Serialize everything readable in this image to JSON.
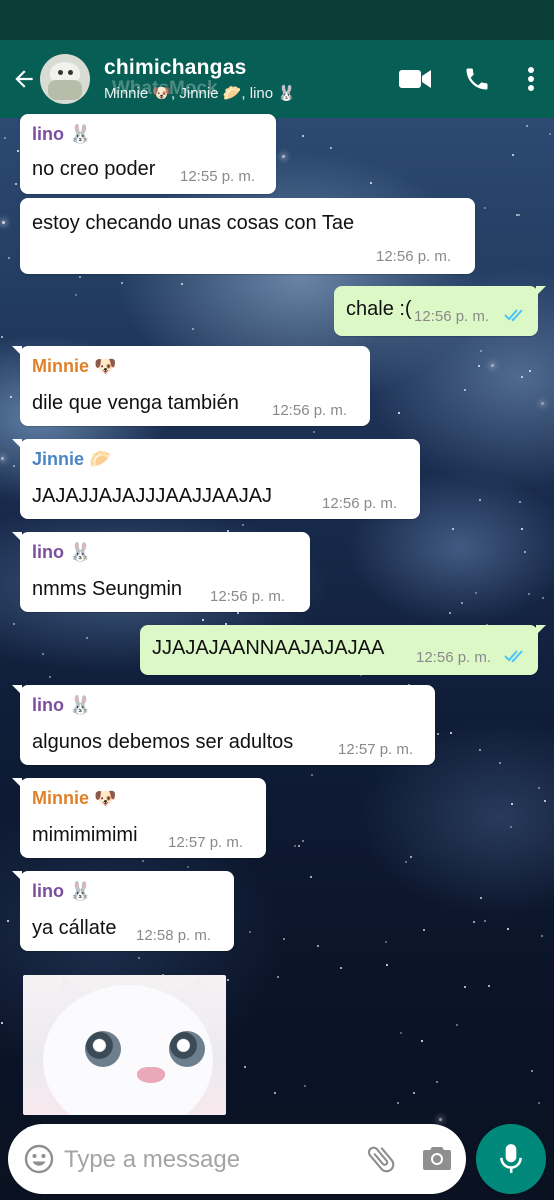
{
  "header": {
    "chat_name": "chimichangas",
    "members": "Minnie 🐶, Jinnie 🥟, lino 🐰",
    "watermark": "WhatsMock"
  },
  "colors": {
    "header": "#075e54",
    "status_bar": "#0a3d35",
    "outgoing_bubble": "#dcf8c6",
    "incoming_bubble": "#ffffff",
    "read_ticks": "#4fc3f7",
    "mic_button": "#00897b",
    "sender_lino": "#7b4f9e",
    "sender_minnie": "#e0812a",
    "sender_jinnie": "#4a86c5"
  },
  "messages": [
    {
      "dir": "in",
      "sender": "lino 🐰",
      "text": "no creo poder",
      "time": "12:55 p. m."
    },
    {
      "dir": "in",
      "sender": "",
      "text": "estoy checando unas cosas con Tae",
      "time": "12:56 p. m."
    },
    {
      "dir": "out",
      "text": "chale :(",
      "time": "12:56 p. m.",
      "ticks": "read"
    },
    {
      "dir": "in",
      "sender": "Minnie 🐶",
      "text": "dile que venga también",
      "time": "12:56 p. m."
    },
    {
      "dir": "in",
      "sender": "Jinnie 🥟",
      "text": "JAJAJJAJAJJJAAJJAAJAJ",
      "time": "12:56 p. m."
    },
    {
      "dir": "in",
      "sender": "lino 🐰",
      "text": "nmms Seungmin",
      "time": "12:56 p. m."
    },
    {
      "dir": "out",
      "text": "JJAJAJAANNAAJAJAJAA",
      "time": "12:56 p. m.",
      "ticks": "read"
    },
    {
      "dir": "in",
      "sender": "lino 🐰",
      "text": "algunos debemos ser adultos",
      "time": "12:57 p. m."
    },
    {
      "dir": "in",
      "sender": "Minnie 🐶",
      "text": "mimimimimi",
      "time": "12:57 p. m."
    },
    {
      "dir": "in",
      "sender": "lino 🐰",
      "text": "ya cállate",
      "time": "12:58 p. m."
    }
  ],
  "image_message": {
    "description": "white kitten photo"
  },
  "input": {
    "placeholder": "Type a message"
  },
  "icons": {
    "back": "arrow-left-icon",
    "video": "video-call-icon",
    "call": "phone-icon",
    "menu": "more-vert-icon",
    "emoji": "emoji-icon",
    "attach": "paperclip-icon",
    "camera": "camera-icon",
    "mic": "mic-icon"
  }
}
